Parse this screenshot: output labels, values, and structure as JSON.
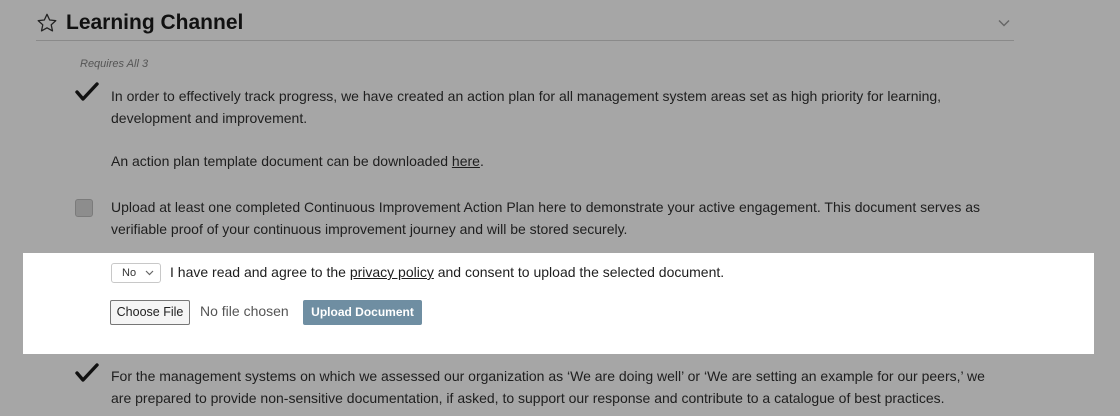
{
  "section": {
    "title": "Learning Channel",
    "requires": "Requires All 3"
  },
  "items": [
    {
      "checked": true,
      "text_line1": "In order to effectively track progress, we have created an action plan for all management system areas set as high priority for learning,",
      "text_line2": "development and improvement.",
      "template_text": "An action plan template document can be downloaded ",
      "template_link": "here",
      "template_after": "."
    },
    {
      "checked": false,
      "text_line1": "Upload at least one completed Continuous Improvement Action Plan here to demonstrate your active engagement. This document serves as",
      "text_line2": "verifiable proof of your continuous improvement journey and will be stored securely."
    },
    {
      "checked": true,
      "text_line1": "For the management systems on which we assessed our organization as ‘We are doing well’ or ‘We are setting an example for our peers,’ we",
      "text_line2": "are prepared to provide non-sensitive documentation, if asked, to support our response and contribute to a catalogue of best practices."
    }
  ],
  "upload_panel": {
    "consent_select": "No",
    "agree_before": "I have read and agree to the ",
    "agree_link": "privacy policy",
    "agree_after": " and consent to upload the selected document.",
    "choose_file": "Choose File",
    "no_file": "No file chosen",
    "upload_button": "Upload Document"
  },
  "colors": {
    "overlay_bg": "#a6a6a6",
    "panel_bg": "#ffffff",
    "upload_button": "#6f8ea2"
  },
  "icons": [
    "star-outline-icon",
    "chevron-down-icon",
    "checkmark-icon"
  ]
}
